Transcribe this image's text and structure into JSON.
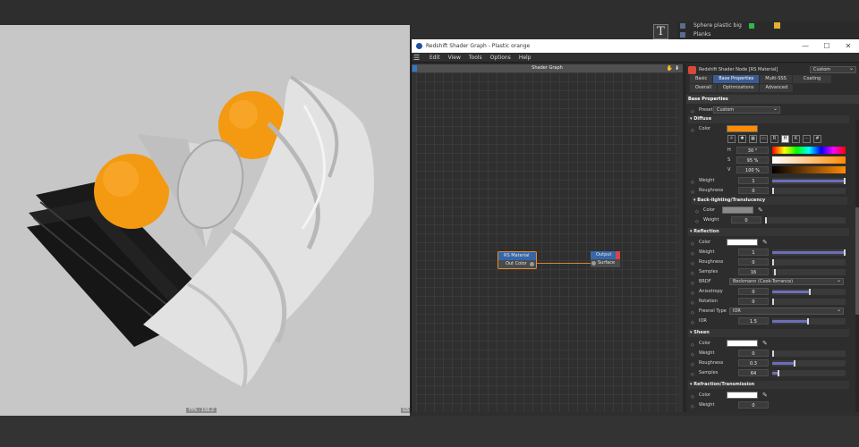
{
  "scene_list": {
    "items": [
      "Sphere plastic big",
      "Planks"
    ]
  },
  "text_tool_label": "T",
  "viewport": {
    "fps": "FPS : 156.2",
    "corner_label": "GS"
  },
  "window": {
    "title": "Redshift Shader Graph - Plastic orange",
    "controls": {
      "minimize": "—",
      "maximize": "☐",
      "close": "✕"
    },
    "menu": [
      "Edit",
      "View",
      "Tools",
      "Options",
      "Help"
    ]
  },
  "graph": {
    "header": "Shader Graph",
    "header_icons": "✋ ⬇",
    "nodes": {
      "rs_material": {
        "title": "RS Material",
        "port": "Out Color"
      },
      "output": {
        "title": "Output",
        "port": "Surface"
      }
    }
  },
  "props": {
    "header_title": "Redshift Shader Node [RS Material]",
    "header_dropdown": "Custom",
    "tabs_row1": [
      "Basic",
      "Base Properties",
      "Multi-SSS",
      "Coating"
    ],
    "tabs_row2": [
      "Overall",
      "Optimizations",
      "Advanced"
    ],
    "active_tab": "Base Properties",
    "section": "Base Properties",
    "preset_label": "Preset",
    "preset_value": "Custom",
    "diffuse": {
      "head": "Diffuse",
      "color_label": "Color",
      "color_hex": "#ff8c00",
      "picker_icons": [
        "☼",
        "✱",
        "▦",
        "▭",
        "R",
        "H",
        "K",
        "⋯",
        "#"
      ],
      "h_label": "H",
      "h_value": "30 °",
      "s_label": "S",
      "s_value": "95 %",
      "v_label": "V",
      "v_value": "100 %",
      "weight_label": "Weight",
      "weight_value": "1",
      "weight_level": 1.0,
      "roughness_label": "Roughness",
      "roughness_value": "0"
    },
    "backlighting": {
      "head": "Back-lighting/Translucency",
      "color_label": "Color",
      "weight_label": "Weight",
      "weight_value": "0"
    },
    "reflection": {
      "head": "Reflection",
      "color_label": "Color",
      "weight_label": "Weight",
      "weight_value": "1",
      "roughness_label": "Roughness",
      "roughness_value": "0",
      "samples_label": "Samples",
      "samples_value": "16",
      "brdf_label": "BRDF",
      "brdf_value": "Beckmann (Cook-Torrance)",
      "anisotropy_label": "Anisotropy",
      "anisotropy_value": "0",
      "rotation_label": "Rotation",
      "rotation_value": "0",
      "fresnel_label": "Fresnel Type",
      "fresnel_value": "IOR",
      "ior_label": "IOR",
      "ior_value": "1.5"
    },
    "sheen": {
      "head": "Sheen",
      "color_label": "Color",
      "weight_label": "Weight",
      "weight_value": "0",
      "roughness_label": "Roughness",
      "roughness_value": "0.3",
      "samples_label": "Samples",
      "samples_value": "64"
    },
    "refraction": {
      "head": "Refraction/Transmission",
      "color_label": "Color",
      "weight_label": "Weight",
      "weight_value": "0"
    }
  },
  "colors": {
    "accent_blue": "#3b5c93",
    "node_border": "#e38a2f",
    "swatch_orange": "#ff8c00",
    "slider_fill": "#6b6fb8"
  }
}
